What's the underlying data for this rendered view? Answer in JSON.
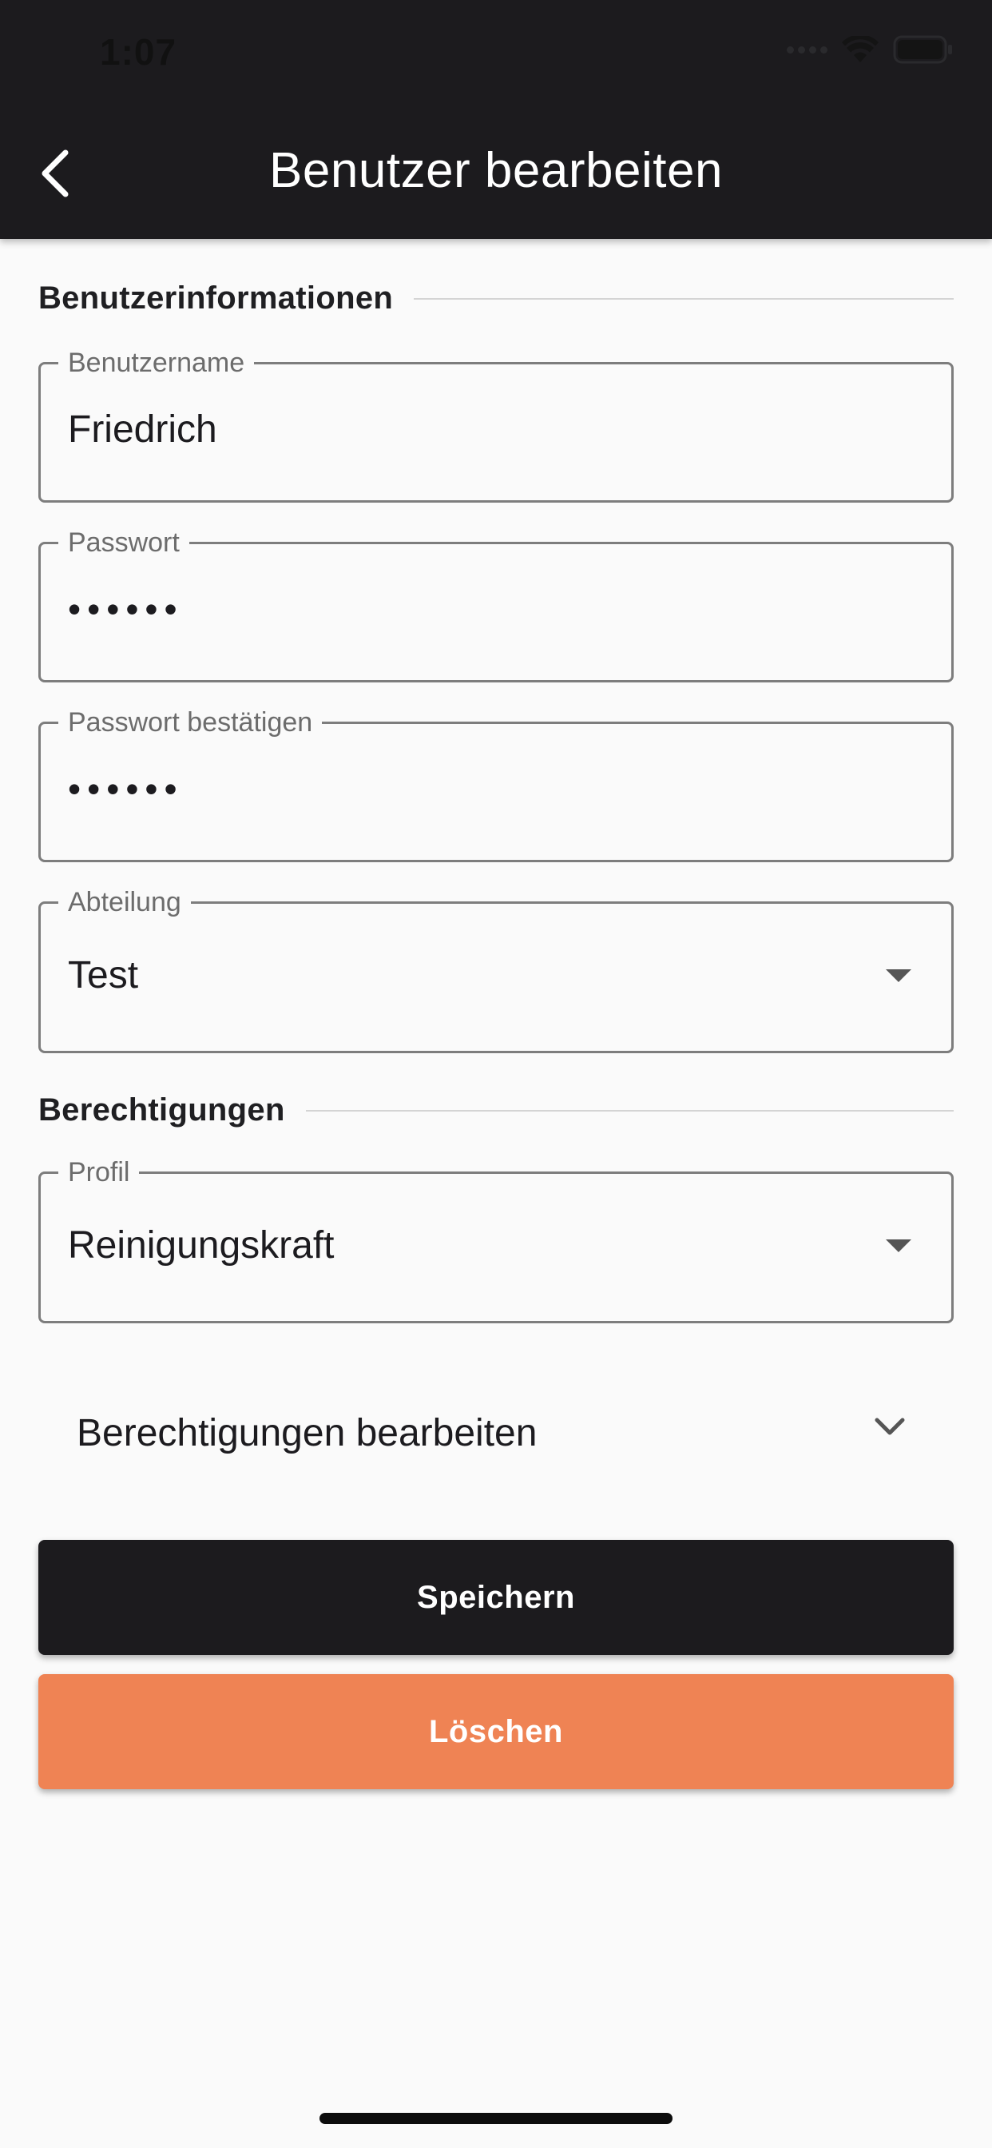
{
  "status_bar": {
    "time": "1:07"
  },
  "app_bar": {
    "title": "Benutzer bearbeiten",
    "back_icon": "chevron-left-icon"
  },
  "sections": {
    "user_info": "Benutzerinformationen",
    "permissions": "Berechtigungen"
  },
  "fields": {
    "username": {
      "label": "Benutzername",
      "value": "Friedrich"
    },
    "password": {
      "label": "Passwort",
      "value": "••••••"
    },
    "password_confirm": {
      "label": "Passwort bestätigen",
      "value": "••••••"
    },
    "department": {
      "label": "Abteilung",
      "value": "Test"
    },
    "profile": {
      "label": "Profil",
      "value": "Reinigungskraft"
    }
  },
  "expansion": {
    "label": "Berechtigungen bearbeiten",
    "icon": "chevron-down-icon"
  },
  "buttons": {
    "save": "Speichern",
    "delete": "Löschen"
  },
  "colors": {
    "app_bar": "#1c1b1e",
    "save_button": "#1c1b1e",
    "delete_button": "#ef8354",
    "background": "#fafafa"
  }
}
